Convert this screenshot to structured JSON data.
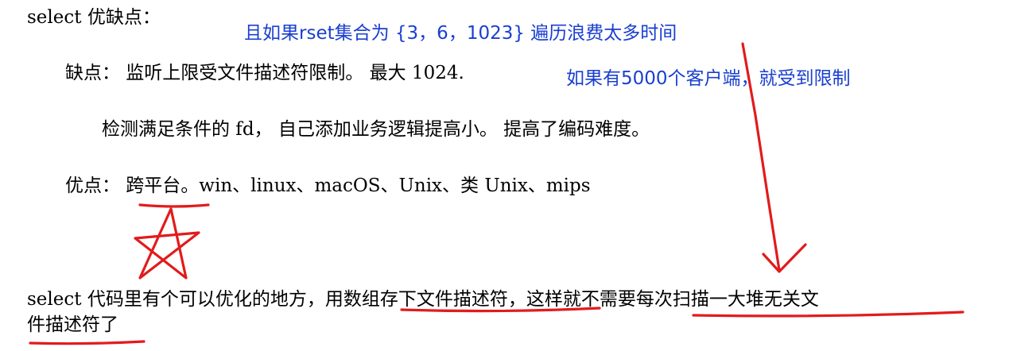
{
  "document": {
    "title": "select 优缺点：",
    "cons_line_1": "缺点：  监听上限受文件描述符限制。  最大 1024.",
    "cons_line_2": "检测满足条件的 fd，  自己添加业务逻辑提高小。  提高了编码难度。",
    "pros_line": "优点：  跨平台。win、linux、macOS、Unix、类 Unix、mips",
    "optimization_line_1": "select 代码里有个可以优化的地方，用数组存下文件描述符，这样就不需要每次扫描一大堆无关文",
    "optimization_line_2": "件描述符了"
  },
  "handwritten_notes": {
    "note_rset": "且如果rset集合为 {3，6，1023} 遍历浪费太多时间",
    "note_clients": "如果有5000个客户端，就受到限制",
    "note_color": "#1a3fd0"
  },
  "markup_colors": {
    "ink": "#e21b1b"
  }
}
